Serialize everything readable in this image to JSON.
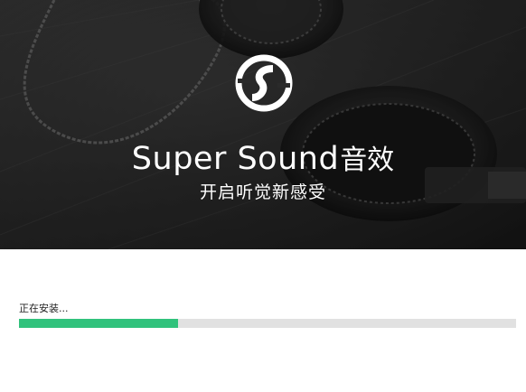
{
  "hero": {
    "brand_en": "Super Sound",
    "brand_cn": "音效",
    "subtitle": "开启听觉新感受"
  },
  "install": {
    "status_text": "正在安装...",
    "progress_fraction": 0.32
  },
  "colors": {
    "accent": "#31c27c",
    "track": "#e1e1e1",
    "hero_bg": "#262626"
  },
  "icons": {
    "logo": "super-sound-logo-icon"
  }
}
